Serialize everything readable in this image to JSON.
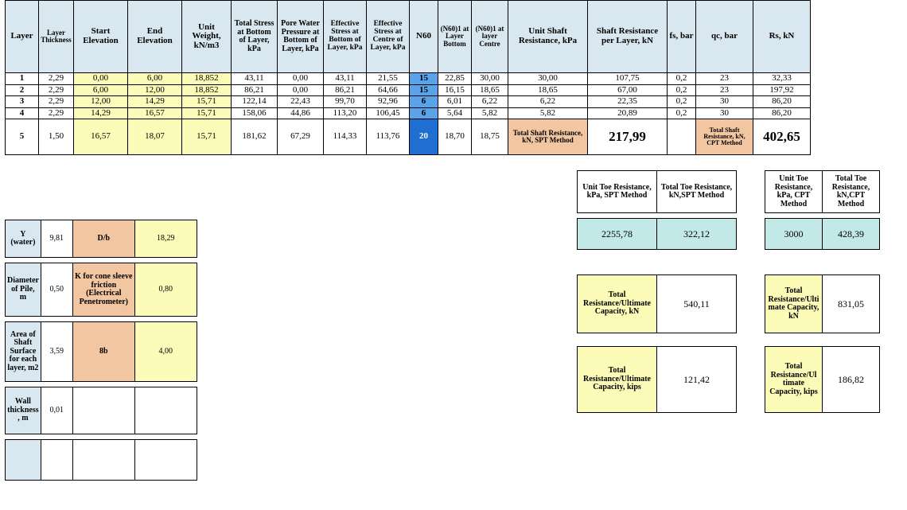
{
  "headers": {
    "layer": "Layer",
    "thk": "Layer Thickness",
    "startEl": "Start Elevation",
    "endEl": "End Elevation",
    "unitW": "Unit Weight, kN/m3",
    "totStr": "Total Stress at Bottom of Layer, kPa",
    "pore": "Pore Water Pressure at Bottom of Layer, kPa",
    "effB": "Effective Stress at Bottom of Layer, kPa",
    "effC": "Effective Stress at Centre of Layer, kPa",
    "n60": "N60",
    "n60b": "(N60)1 at Layer Bottom",
    "n60c": "(N60)1 at layer Centre",
    "usr": "Unit Shaft Resistance, kPa",
    "srpl": "Shaft Resistance per Layer, kN",
    "fs": "fs, bar",
    "qc": "qc, bar",
    "rs": "Rs, kN"
  },
  "rows": [
    {
      "i": "1",
      "thk": "2,29",
      "se": "0,00",
      "ee": "6,00",
      "uw": "18,852",
      "ts": "43,11",
      "pw": "0,00",
      "eb": "43,11",
      "ec": "21,55",
      "n60": "15",
      "nb": "22,85",
      "nc": "30,00",
      "usr": "30,00",
      "srpl": "107,75",
      "fs": "0,2",
      "qc": "23",
      "rs": "32,33"
    },
    {
      "i": "2",
      "thk": "2,29",
      "se": "6,00",
      "ee": "12,00",
      "uw": "18,852",
      "ts": "86,21",
      "pw": "0,00",
      "eb": "86,21",
      "ec": "64,66",
      "n60": "15",
      "nb": "16,15",
      "nc": "18,65",
      "usr": "18,65",
      "srpl": "67,00",
      "fs": "0,2",
      "qc": "23",
      "rs": "197,92"
    },
    {
      "i": "3",
      "thk": "2,29",
      "se": "12,00",
      "ee": "14,29",
      "uw": "15,71",
      "ts": "122,14",
      "pw": "22,43",
      "eb": "99,70",
      "ec": "92,96",
      "n60": "6",
      "nb": "6,01",
      "nc": "6,22",
      "usr": "6,22",
      "srpl": "22,35",
      "fs": "0,2",
      "qc": "30",
      "rs": "86,20"
    },
    {
      "i": "4",
      "thk": "2,29",
      "se": "14,29",
      "ee": "16,57",
      "uw": "15,71",
      "ts": "158,06",
      "pw": "44,86",
      "eb": "113,20",
      "ec": "106,45",
      "n60": "6",
      "nb": "5,64",
      "nc": "5,82",
      "usr": "5,82",
      "srpl": "20,89",
      "fs": "0,2",
      "qc": "30",
      "rs": "86,20"
    },
    {
      "i": "5",
      "thk": "1,50",
      "se": "16,57",
      "ee": "18,07",
      "uw": "15,71",
      "ts": "181,62",
      "pw": "67,29",
      "eb": "114,33",
      "ec": "113,76",
      "n60": "20",
      "nb": "18,70",
      "nc": "18,75"
    }
  ],
  "row5tail": {
    "usrLabel": "Total Shaft Resistance, kN, SPT Method",
    "srpl": "217,99",
    "qcLabel": "Total Shaft Resistance, kN, CPT Method",
    "rs": "402,65"
  },
  "toeHdr": {
    "u": "Unit Toe Resistance, kPa, SPT Method",
    "t": "Total Toe Resistance, kN,SPT Method",
    "u2": "Unit Toe Resistance, kPa, CPT Method",
    "t2": "Total Toe Resistance, kN,CPT Method"
  },
  "toeVal": {
    "a": "2255,78",
    "b": "322,12",
    "c": "3000",
    "d": "428,39"
  },
  "resA": {
    "l1": "Total Resistance/Ultimate Capacity, kN",
    "v1": "540,11",
    "l2": "Total Resistance/Ulti mate Capacity, kN",
    "v2": "831,05"
  },
  "resB": {
    "l1": "Total Resistance/Ultimate Capacity, kips",
    "v1": "121,42",
    "l2": "Total Resistance/Ul timate Capacity, kips",
    "v2": "186,82"
  },
  "params": {
    "yw_l": "Y (water)",
    "yw_v": "9,81",
    "db_l": "D/b",
    "db_v": "18,29",
    "dia_l": "Diameter of Pile, m",
    "dia_v": "0,50",
    "k_l": "K for cone sleeve friction (Electrical Penetrometer)",
    "k_v": "0,80",
    "area_l": "Area of Shaft Surface for each layer, m2",
    "area_v": "3,59",
    "eb_l": "8b",
    "eb_v": "4,00",
    "wt_l": "Wall thickness , m",
    "wt_v": "0,01"
  }
}
